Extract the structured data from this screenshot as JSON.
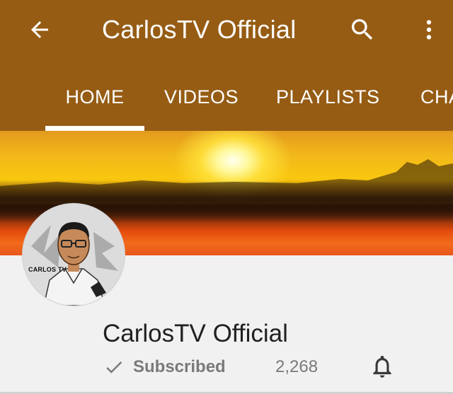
{
  "header": {
    "title": "CarlosTV Official",
    "background_color": "#965c14",
    "icons": [
      "back-arrow-icon",
      "search-icon",
      "more-vert-icon"
    ]
  },
  "tabs": [
    {
      "label": "HOME",
      "selected": true
    },
    {
      "label": "VIDEOS",
      "selected": false
    },
    {
      "label": "PLAYLISTS",
      "selected": false
    },
    {
      "label": "CHA",
      "selected": false
    }
  ],
  "avatar": {
    "text": "CARLOS TV"
  },
  "channel": {
    "name": "CarlosTV Official",
    "subscribe_label": "Subscribed",
    "subscriber_count": "2,268",
    "icons": [
      "check-icon",
      "bell-icon"
    ]
  },
  "colors": {
    "tab_indicator": "#ffffff",
    "body_background": "#f1f1f1",
    "muted_text": "#7a7a7a"
  }
}
